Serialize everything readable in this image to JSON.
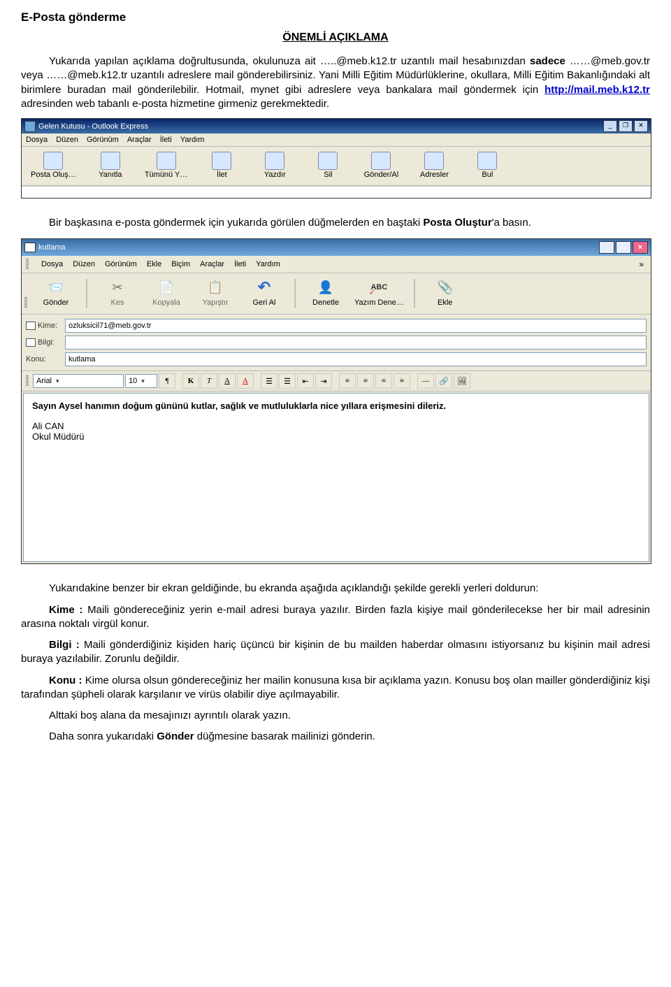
{
  "doc": {
    "title": "E-Posta gönderme",
    "subtitle": "ÖNEMLİ AÇIKLAMA",
    "para1_a": "Yukarıda yapılan açıklama doğrultusunda, okulunuza ait …..@meb.k12.tr uzantılı mail hesabınızdan ",
    "para1_b": "sadece",
    "para1_c": " ……@meb.gov.tr veya ……@meb.k12.tr uzantılı adreslere mail gönderebilirsiniz. Yani Milli Eğitim Müdürlüklerine, okullara, Milli Eğitim Bakanlığındaki alt birimlere buradan mail gönderilebilir. Hotmail, mynet gibi adreslere veya bankalara mail göndermek için ",
    "para1_link": "http://mail.meb.k12.tr",
    "para1_d": " adresinden web tabanlı e-posta hizmetine girmeniz gerekmektedir.",
    "para2_a": "Bir başkasına e-posta göndermek için yukarıda görülen düğmelerden en baştaki ",
    "para2_b": "Posta Oluştur",
    "para2_c": "'a basın.",
    "para3": "Yukarıdakine benzer bir ekran geldiğinde, bu ekranda aşağıda açıklandığı şekilde gerekli yerleri doldurun:",
    "para_kime_a": "Kime :",
    "para_kime_b": " Maili göndereceğiniz yerin e-mail adresi buraya yazılır. Birden fazla kişiye mail gönderilecekse her bir mail adresinin arasına noktalı virgül konur.",
    "para_bilgi_a": "Bilgi :",
    "para_bilgi_b": " Maili gönderdiğiniz kişiden hariç üçüncü bir kişinin de bu mailden haberdar olmasını istiyorsanız bu kişinin mail adresi buraya yazılabilir. Zorunlu değildir.",
    "para_konu_a": "Konu :",
    "para_konu_b": " Kime olursa olsun göndereceğiniz her mailin konusuna kısa bir açıklama yazın. Konusu boş olan mailler gönderdiğiniz kişi tarafından şüpheli olarak karşılanır ve virüs olabilir diye açılmayabilir.",
    "para_alt": "Alttaki boş alana da mesajınızı ayrıntılı olarak yazın.",
    "para_son_a": "Daha sonra yukarıdaki ",
    "para_son_b": "Gönder",
    "para_son_c": " düğmesine basarak mailinizi gönderin."
  },
  "inbox": {
    "title": "Gelen Kutusu - Outlook Express",
    "menus": [
      "Dosya",
      "Düzen",
      "Görünüm",
      "Araçlar",
      "İleti",
      "Yardım"
    ],
    "toolbar": [
      "Posta Oluş…",
      "Yanıtla",
      "Tümünü Y…",
      "İlet",
      "Yazdır",
      "Sil",
      "Gönder/Al",
      "Adresler",
      "Bul"
    ]
  },
  "compose": {
    "title": "kutlama",
    "menus": [
      "Dosya",
      "Düzen",
      "Görünüm",
      "Ekle",
      "Biçim",
      "Araçlar",
      "İleti",
      "Yardım"
    ],
    "toolbar": [
      {
        "label": "Gönder",
        "glyph": "send",
        "dim": false
      },
      {
        "label": "Kes",
        "glyph": "cut",
        "dim": true
      },
      {
        "label": "Kopyala",
        "glyph": "copy",
        "dim": true
      },
      {
        "label": "Yapıştır",
        "glyph": "paste",
        "dim": true
      },
      {
        "label": "Geri Al",
        "glyph": "undo",
        "dim": false
      },
      {
        "label": "Denetle",
        "glyph": "check",
        "dim": false
      },
      {
        "label": "Yazım Dene…",
        "glyph": "spell",
        "dim": false
      },
      {
        "label": "Ekle",
        "glyph": "attach",
        "dim": false
      }
    ],
    "fields": {
      "kime_label": "Kime:",
      "kime_val": "ozluksicil71@meb.gov.tr",
      "bilgi_label": "Bilgi:",
      "bilgi_val": "",
      "konu_label": "Konu:",
      "konu_val": "kutlama"
    },
    "font": "Arial",
    "size": "10",
    "body_line1": "Sayın Aysel hanımın doğum gününü kutlar, sağlık ve mutluluklarla nice yıllara erişmesini dileriz.",
    "body_line2": "Ali CAN",
    "body_line3": "Okul Müdürü"
  }
}
